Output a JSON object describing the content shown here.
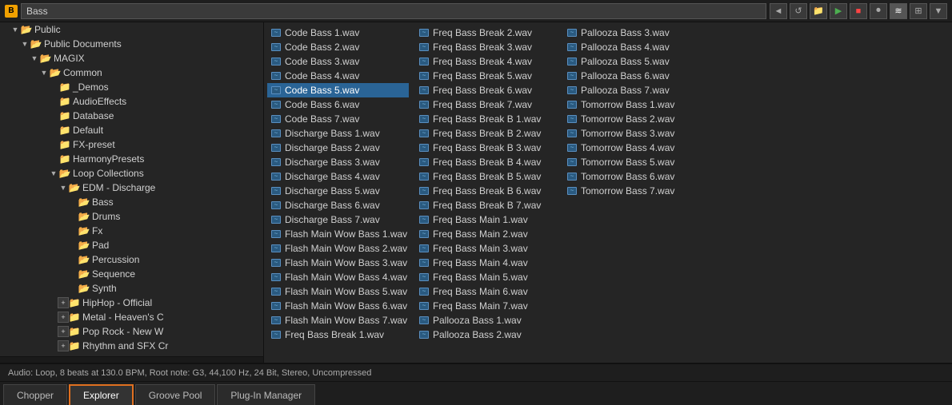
{
  "titleBar": {
    "icon": "B",
    "searchValue": "Bass",
    "buttons": [
      "back",
      "forward",
      "folder",
      "play",
      "stop",
      "record",
      "grid",
      "layout"
    ]
  },
  "tree": {
    "items": [
      {
        "id": "public",
        "label": "Public",
        "indent": 1,
        "type": "folder",
        "expanded": true,
        "hasArrow": true
      },
      {
        "id": "public-docs",
        "label": "Public Documents",
        "indent": 2,
        "type": "folder",
        "expanded": true,
        "hasArrow": true
      },
      {
        "id": "magix",
        "label": "MAGIX",
        "indent": 3,
        "type": "folder",
        "expanded": true,
        "hasArrow": true
      },
      {
        "id": "common",
        "label": "Common",
        "indent": 4,
        "type": "folder",
        "expanded": true,
        "hasArrow": true
      },
      {
        "id": "demos",
        "label": "_Demos",
        "indent": 5,
        "type": "folder",
        "expanded": false,
        "hasArrow": false
      },
      {
        "id": "audioeffects",
        "label": "AudioEffects",
        "indent": 5,
        "type": "folder",
        "expanded": false,
        "hasArrow": false
      },
      {
        "id": "database",
        "label": "Database",
        "indent": 5,
        "type": "folder",
        "expanded": false,
        "hasArrow": false
      },
      {
        "id": "default",
        "label": "Default",
        "indent": 5,
        "type": "folder",
        "expanded": false,
        "hasArrow": false
      },
      {
        "id": "fx-preset",
        "label": "FX-preset",
        "indent": 5,
        "type": "folder",
        "expanded": false,
        "hasArrow": false
      },
      {
        "id": "harmonypresets",
        "label": "HarmonyPresets",
        "indent": 5,
        "type": "folder",
        "expanded": false,
        "hasArrow": false
      },
      {
        "id": "loop-collections",
        "label": "Loop Collections",
        "indent": 5,
        "type": "folder",
        "expanded": true,
        "hasArrow": true
      },
      {
        "id": "edm-discharge",
        "label": "EDM - Discharge",
        "indent": 6,
        "type": "folder",
        "expanded": true,
        "hasArrow": true
      },
      {
        "id": "bass",
        "label": "Bass",
        "indent": 7,
        "type": "folder-yellow",
        "expanded": false,
        "hasArrow": false,
        "selected": false
      },
      {
        "id": "drums",
        "label": "Drums",
        "indent": 7,
        "type": "folder-yellow",
        "expanded": false,
        "hasArrow": false
      },
      {
        "id": "fx",
        "label": "Fx",
        "indent": 7,
        "type": "folder-yellow",
        "expanded": false,
        "hasArrow": false
      },
      {
        "id": "pad",
        "label": "Pad",
        "indent": 7,
        "type": "folder-yellow",
        "expanded": false,
        "hasArrow": false
      },
      {
        "id": "percussion",
        "label": "Percussion",
        "indent": 7,
        "type": "folder-yellow",
        "expanded": false,
        "hasArrow": false
      },
      {
        "id": "sequence",
        "label": "Sequence",
        "indent": 7,
        "type": "folder-yellow",
        "expanded": false,
        "hasArrow": false
      },
      {
        "id": "synth",
        "label": "Synth",
        "indent": 7,
        "type": "folder-yellow",
        "expanded": false,
        "hasArrow": false
      },
      {
        "id": "hiphop-official",
        "label": "HipHop - Official",
        "indent": 6,
        "type": "folder",
        "expanded": false,
        "hasArrow": false,
        "hasExpand": true
      },
      {
        "id": "metal-heavens",
        "label": "Metal - Heaven's C",
        "indent": 6,
        "type": "folder",
        "expanded": false,
        "hasArrow": false,
        "hasExpand": true
      },
      {
        "id": "pop-rock-new",
        "label": "Pop Rock - New W",
        "indent": 6,
        "type": "folder",
        "expanded": false,
        "hasArrow": false,
        "hasExpand": true
      },
      {
        "id": "rhythm-sfx",
        "label": "Rhythm and SFX Cr",
        "indent": 6,
        "type": "folder",
        "expanded": false,
        "hasArrow": false,
        "hasExpand": true
      }
    ]
  },
  "files": {
    "col1": [
      {
        "id": "f1",
        "name": "Code Bass 1.wav",
        "selected": false
      },
      {
        "id": "f2",
        "name": "Code Bass 2.wav",
        "selected": false
      },
      {
        "id": "f3",
        "name": "Code Bass 3.wav",
        "selected": false
      },
      {
        "id": "f4",
        "name": "Code Bass 4.wav",
        "selected": false
      },
      {
        "id": "f5",
        "name": "Code Bass 5.wav",
        "selected": true
      },
      {
        "id": "f6",
        "name": "Code Bass 6.wav",
        "selected": false
      },
      {
        "id": "f7",
        "name": "Code Bass 7.wav",
        "selected": false
      },
      {
        "id": "f8",
        "name": "Discharge Bass 1.wav",
        "selected": false
      },
      {
        "id": "f9",
        "name": "Discharge Bass 2.wav",
        "selected": false
      },
      {
        "id": "f10",
        "name": "Discharge Bass 3.wav",
        "selected": false
      },
      {
        "id": "f11",
        "name": "Discharge Bass 4.wav",
        "selected": false
      },
      {
        "id": "f12",
        "name": "Discharge Bass 5.wav",
        "selected": false
      },
      {
        "id": "f13",
        "name": "Discharge Bass 6.wav",
        "selected": false
      },
      {
        "id": "f14",
        "name": "Discharge Bass 7.wav",
        "selected": false
      },
      {
        "id": "f15",
        "name": "Flash Main Wow Bass 1.wav",
        "selected": false
      },
      {
        "id": "f16",
        "name": "Flash Main Wow Bass 2.wav",
        "selected": false
      },
      {
        "id": "f17",
        "name": "Flash Main Wow Bass 3.wav",
        "selected": false
      },
      {
        "id": "f18",
        "name": "Flash Main Wow Bass 4.wav",
        "selected": false
      },
      {
        "id": "f19",
        "name": "Flash Main Wow Bass 5.wav",
        "selected": false
      },
      {
        "id": "f20",
        "name": "Flash Main Wow Bass 6.wav",
        "selected": false
      },
      {
        "id": "f21",
        "name": "Flash Main Wow Bass 7.wav",
        "selected": false
      },
      {
        "id": "f22",
        "name": "Freq Bass Break 1.wav",
        "selected": false
      }
    ],
    "col2": [
      {
        "id": "g1",
        "name": "Freq Bass Break 2.wav",
        "selected": false
      },
      {
        "id": "g2",
        "name": "Freq Bass Break 3.wav",
        "selected": false
      },
      {
        "id": "g3",
        "name": "Freq Bass Break 4.wav",
        "selected": false
      },
      {
        "id": "g4",
        "name": "Freq Bass Break 5.wav",
        "selected": false
      },
      {
        "id": "g5",
        "name": "Freq Bass Break 6.wav",
        "selected": false
      },
      {
        "id": "g6",
        "name": "Freq Bass Break 7.wav",
        "selected": false
      },
      {
        "id": "g7",
        "name": "Freq Bass Break B 1.wav",
        "selected": false
      },
      {
        "id": "g8",
        "name": "Freq Bass Break B 2.wav",
        "selected": false
      },
      {
        "id": "g9",
        "name": "Freq Bass Break B 3.wav",
        "selected": false
      },
      {
        "id": "g10",
        "name": "Freq Bass Break B 4.wav",
        "selected": false
      },
      {
        "id": "g11",
        "name": "Freq Bass Break B 5.wav",
        "selected": false
      },
      {
        "id": "g12",
        "name": "Freq Bass Break B 6.wav",
        "selected": false
      },
      {
        "id": "g13",
        "name": "Freq Bass Break B 7.wav",
        "selected": false
      },
      {
        "id": "g14",
        "name": "Freq Bass Main 1.wav",
        "selected": false
      },
      {
        "id": "g15",
        "name": "Freq Bass Main 2.wav",
        "selected": false
      },
      {
        "id": "g16",
        "name": "Freq Bass Main 3.wav",
        "selected": false
      },
      {
        "id": "g17",
        "name": "Freq Bass Main 4.wav",
        "selected": false
      },
      {
        "id": "g18",
        "name": "Freq Bass Main 5.wav",
        "selected": false
      },
      {
        "id": "g19",
        "name": "Freq Bass Main 6.wav",
        "selected": false
      },
      {
        "id": "g20",
        "name": "Freq Bass Main 7.wav",
        "selected": false
      },
      {
        "id": "g21",
        "name": "Pallooza Bass 1.wav",
        "selected": false
      },
      {
        "id": "g22",
        "name": "Pallooza Bass 2.wav",
        "selected": false
      }
    ],
    "col3": [
      {
        "id": "h1",
        "name": "Pallooza Bass 3.wav",
        "selected": false
      },
      {
        "id": "h2",
        "name": "Pallooza Bass 4.wav",
        "selected": false
      },
      {
        "id": "h3",
        "name": "Pallooza Bass 5.wav",
        "selected": false
      },
      {
        "id": "h4",
        "name": "Pallooza Bass 6.wav",
        "selected": false
      },
      {
        "id": "h5",
        "name": "Pallooza Bass 7.wav",
        "selected": false
      },
      {
        "id": "h6",
        "name": "Tomorrow Bass 1.wav",
        "selected": false
      },
      {
        "id": "h7",
        "name": "Tomorrow Bass 2.wav",
        "selected": false
      },
      {
        "id": "h8",
        "name": "Tomorrow Bass 3.wav",
        "selected": false
      },
      {
        "id": "h9",
        "name": "Tomorrow Bass 4.wav",
        "selected": false
      },
      {
        "id": "h10",
        "name": "Tomorrow Bass 5.wav",
        "selected": false
      },
      {
        "id": "h11",
        "name": "Tomorrow Bass 6.wav",
        "selected": false
      },
      {
        "id": "h12",
        "name": "Tomorrow Bass 7.wav",
        "selected": false
      }
    ]
  },
  "statusBar": {
    "text": "Audio: Loop, 8 beats at 130.0 BPM, Root note: G3, 44,100 Hz, 24 Bit, Stereo, Uncompressed"
  },
  "tabs": [
    {
      "id": "chopper",
      "label": "Chopper",
      "active": false
    },
    {
      "id": "explorer",
      "label": "Explorer",
      "active": true
    },
    {
      "id": "groove-pool",
      "label": "Groove Pool",
      "active": false
    },
    {
      "id": "plugin-manager",
      "label": "Plug-In Manager",
      "active": false
    }
  ]
}
